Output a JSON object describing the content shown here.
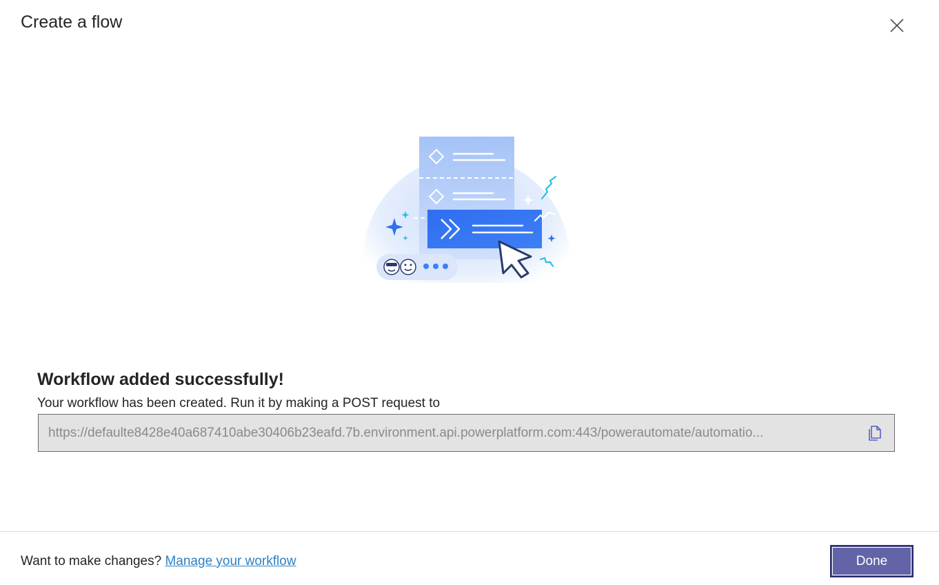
{
  "dialog": {
    "title": "Create a flow"
  },
  "success": {
    "heading": "Workflow added successfully!",
    "description": "Your workflow has been created. Run it by making a POST request to",
    "url": "https://defaulte8428e40a687410abe30406b23eafd.7b.environment.api.powerplatform.com:443/powerautomate/automatio..."
  },
  "footer": {
    "prompt": "Want to make changes?",
    "link_label": "Manage your workflow",
    "done_label": "Done"
  },
  "icons": {
    "close": "close-icon",
    "copy": "copy-icon",
    "illustration": "power-automate-flow-illustration"
  },
  "colors": {
    "primary": "#6264a7",
    "link": "#2f7fc1",
    "flow_blue": "#2f6ef0"
  }
}
